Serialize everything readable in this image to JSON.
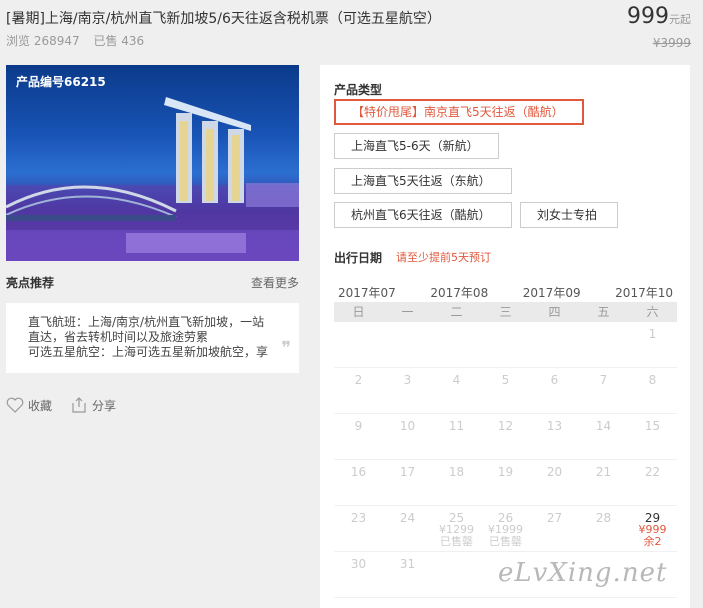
{
  "product": {
    "title": "[暑期]上海/南京/杭州直飞新加坡5/6天往返含税机票（可选五星航空）",
    "views": "浏览 268947",
    "sold": "已售 436",
    "price": "999",
    "price_unit": "元起",
    "original_price": "¥3999",
    "product_no": "产品编号66215"
  },
  "recommend": {
    "heading": "亮点推荐",
    "more": "查看更多",
    "lines": [
      "直飞航班：上海/南京/杭州直飞新加坡，一站",
      "直达，省去转机时间以及旅途劳累",
      "可选五星航空：上海可选五星新加坡航空，享"
    ],
    "quote_icon": "quote-icon"
  },
  "actions": {
    "favorite": "收藏",
    "share": "分享"
  },
  "panel": {
    "type_label": "产品类型",
    "options": [
      "【特价甩尾】南京直飞5天往返（酷航）",
      "上海直飞5-6天（新航）",
      "上海直飞5天往返（东航）",
      "杭州直飞6天往返（酷航）",
      "刘女士专拍"
    ],
    "date_label": "出行日期",
    "date_note": "请至少提前5天预订",
    "months": [
      "2017年07",
      "2017年08",
      "2017年09",
      "2017年10"
    ],
    "weekdays": [
      "日",
      "一",
      "二",
      "三",
      "四",
      "五",
      "六"
    ],
    "cells": [
      {
        "d": ""
      },
      {
        "d": ""
      },
      {
        "d": ""
      },
      {
        "d": ""
      },
      {
        "d": ""
      },
      {
        "d": ""
      },
      {
        "d": "1"
      },
      {
        "d": "2"
      },
      {
        "d": "3"
      },
      {
        "d": "4"
      },
      {
        "d": "5"
      },
      {
        "d": "6"
      },
      {
        "d": "7"
      },
      {
        "d": "8"
      },
      {
        "d": "9"
      },
      {
        "d": "10"
      },
      {
        "d": "11"
      },
      {
        "d": "12"
      },
      {
        "d": "13"
      },
      {
        "d": "14"
      },
      {
        "d": "15"
      },
      {
        "d": "16"
      },
      {
        "d": "17"
      },
      {
        "d": "18"
      },
      {
        "d": "19"
      },
      {
        "d": "20"
      },
      {
        "d": "21"
      },
      {
        "d": "22"
      },
      {
        "d": "23"
      },
      {
        "d": "24"
      },
      {
        "d": "25",
        "p": "¥1299",
        "s": "已售罄"
      },
      {
        "d": "26",
        "p": "¥1999",
        "s": "已售罄"
      },
      {
        "d": "27"
      },
      {
        "d": "28"
      },
      {
        "d": "29",
        "p": "¥999",
        "s": "余2",
        "avail": true
      },
      {
        "d": "30"
      },
      {
        "d": "31"
      },
      {
        "d": ""
      },
      {
        "d": ""
      },
      {
        "d": ""
      },
      {
        "d": ""
      },
      {
        "d": ""
      }
    ]
  },
  "watermark": "eLvXing.net"
}
